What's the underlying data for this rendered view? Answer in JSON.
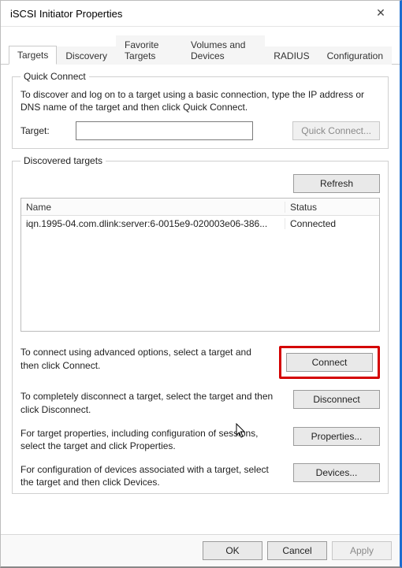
{
  "window": {
    "title": "iSCSI Initiator Properties"
  },
  "tabs": {
    "items": [
      {
        "label": "Targets",
        "active": true
      },
      {
        "label": "Discovery",
        "active": false
      },
      {
        "label": "Favorite Targets",
        "active": false
      },
      {
        "label": "Volumes and Devices",
        "active": false
      },
      {
        "label": "RADIUS",
        "active": false
      },
      {
        "label": "Configuration",
        "active": false
      }
    ]
  },
  "quick_connect": {
    "legend": "Quick Connect",
    "help": "To discover and log on to a target using a basic connection, type the IP address or DNS name of the target and then click Quick Connect.",
    "target_label": "Target:",
    "target_value": "",
    "button_label": "Quick Connect...",
    "button_enabled": false
  },
  "discovered": {
    "legend": "Discovered targets",
    "refresh_label": "Refresh",
    "columns": {
      "name": "Name",
      "status": "Status"
    },
    "rows": [
      {
        "name": "iqn.1995-04.com.dlink:server:6-0015e9-020003e06-386...",
        "status": "Connected"
      }
    ],
    "actions": {
      "connect": {
        "text": "To connect using advanced options, select a target and then click Connect.",
        "label": "Connect",
        "highlight": true
      },
      "disconnect": {
        "text": "To completely disconnect a target, select the target and then click Disconnect.",
        "label": "Disconnect"
      },
      "properties": {
        "text": "For target properties, including configuration of sessions, select the target and click Properties.",
        "label": "Properties..."
      },
      "devices": {
        "text": "For configuration of devices associated with a target, select the target and then click Devices.",
        "label": "Devices..."
      }
    }
  },
  "footer": {
    "ok": "OK",
    "cancel": "Cancel",
    "apply": "Apply",
    "apply_enabled": false
  }
}
